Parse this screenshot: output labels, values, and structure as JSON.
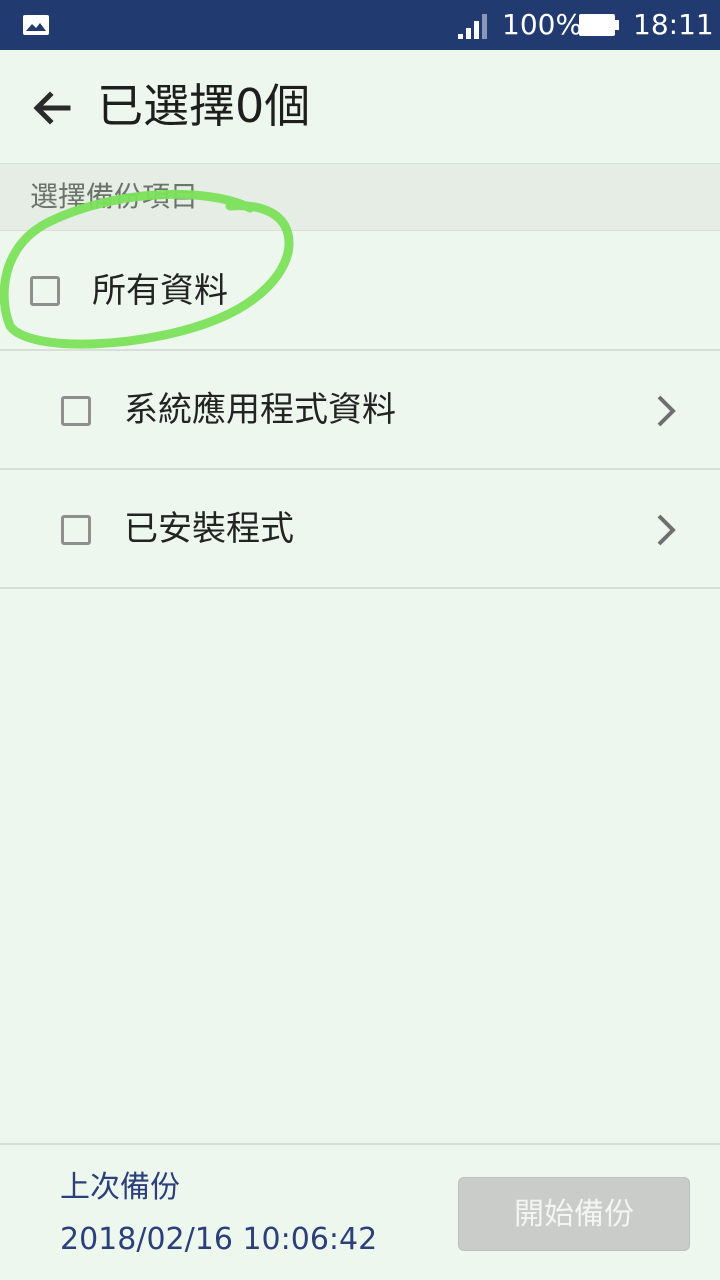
{
  "status_bar": {
    "battery_percent": "100%",
    "time": "18:11",
    "icons": [
      "gallery-icon",
      "signal-icon",
      "battery-icon"
    ]
  },
  "header": {
    "title": "已選擇0個",
    "back_icon": "back-arrow-icon"
  },
  "section": {
    "label": "選擇備份項目"
  },
  "items": [
    {
      "label": "所有資料",
      "checked": false
    },
    {
      "label": "系統應用程式資料",
      "checked": false,
      "chevron": true
    },
    {
      "label": "已安裝程式",
      "checked": false,
      "chevron": true
    }
  ],
  "footer": {
    "last_backup_label": "上次備份",
    "last_backup_time": "2018/02/16 10:06:42",
    "start_button_label": "開始備份"
  },
  "colors": {
    "status_bar": "#213a70",
    "background": "#eef7ee",
    "highlight": "#7be25a",
    "footer_text": "#2b3f7a",
    "button_disabled": "#c9ccc9"
  }
}
